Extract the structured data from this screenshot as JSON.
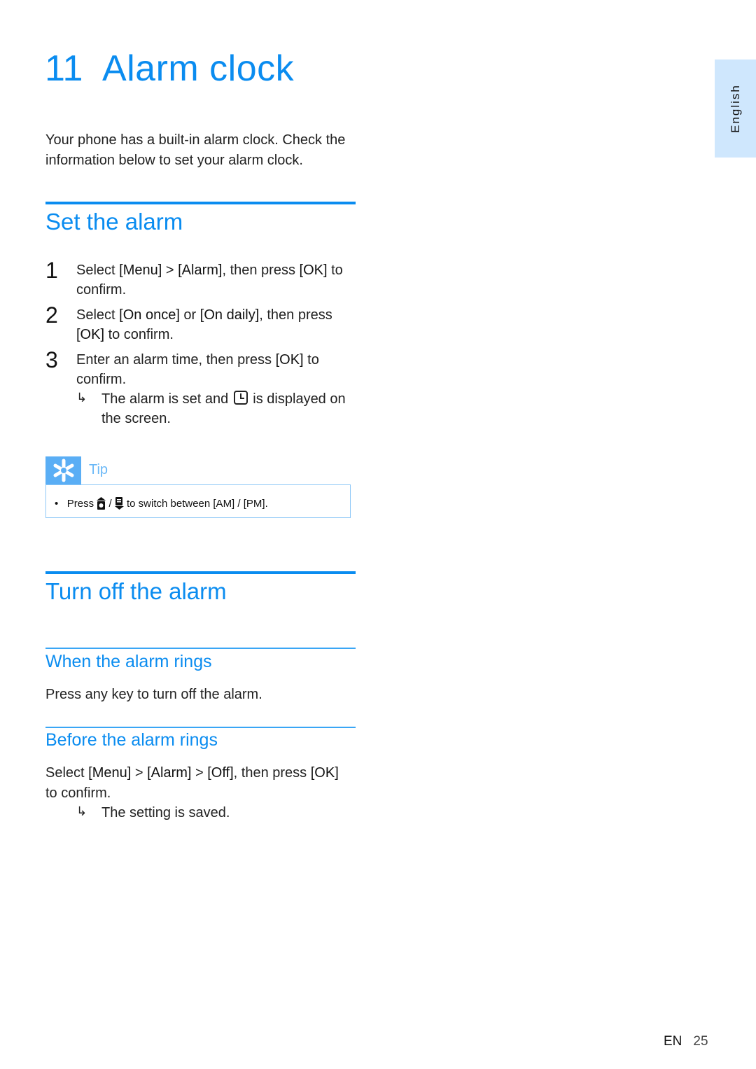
{
  "chapter": {
    "number": "11",
    "title": "Alarm clock"
  },
  "intro": "Your phone has a built-in alarm clock. Check the information below to set your alarm clock.",
  "side_tab": {
    "label": "English"
  },
  "set_alarm": {
    "heading": "Set the alarm",
    "steps": [
      {
        "num": "1",
        "parts": [
          "Select ",
          "[Menu]",
          " > ",
          "[Alarm]",
          ", then press ",
          "[OK]",
          " to confirm."
        ]
      },
      {
        "num": "2",
        "parts": [
          "Select ",
          "[On once]",
          " or ",
          "[On daily]",
          ", then press ",
          "[OK]",
          " to confirm."
        ]
      },
      {
        "num": "3",
        "parts": [
          "Enter an alarm time, then press ",
          "[OK]",
          " to confirm."
        ]
      }
    ],
    "result": {
      "before_icon": "The alarm is set and ",
      "icon": "alarm-clock-icon",
      "after_icon": " is displayed on the screen."
    }
  },
  "tip": {
    "label": "Tip",
    "icon": "asterisk-icon",
    "bullet": "•",
    "text_press": "Press",
    "icon_up": "navigation-up-icon",
    "separator": "/",
    "icon_down": "navigation-down-icon",
    "text_switch": "to switch between",
    "am": "[AM]",
    "slash": "/",
    "pm": "[PM]",
    "end": "."
  },
  "turn_off": {
    "heading": "Turn off the alarm",
    "when_rings": {
      "heading": "When the alarm rings",
      "text": "Press any key to turn off the alarm."
    },
    "before_rings": {
      "heading": "Before the alarm rings",
      "parts": [
        "Select ",
        "[Menu]",
        " > ",
        "[Alarm]",
        " > ",
        "[Off]",
        ", then press ",
        "[OK]",
        " to confirm."
      ],
      "result": "The setting is saved."
    }
  },
  "result_arrow": "↳",
  "footer": {
    "lang": "EN",
    "page": "25"
  }
}
